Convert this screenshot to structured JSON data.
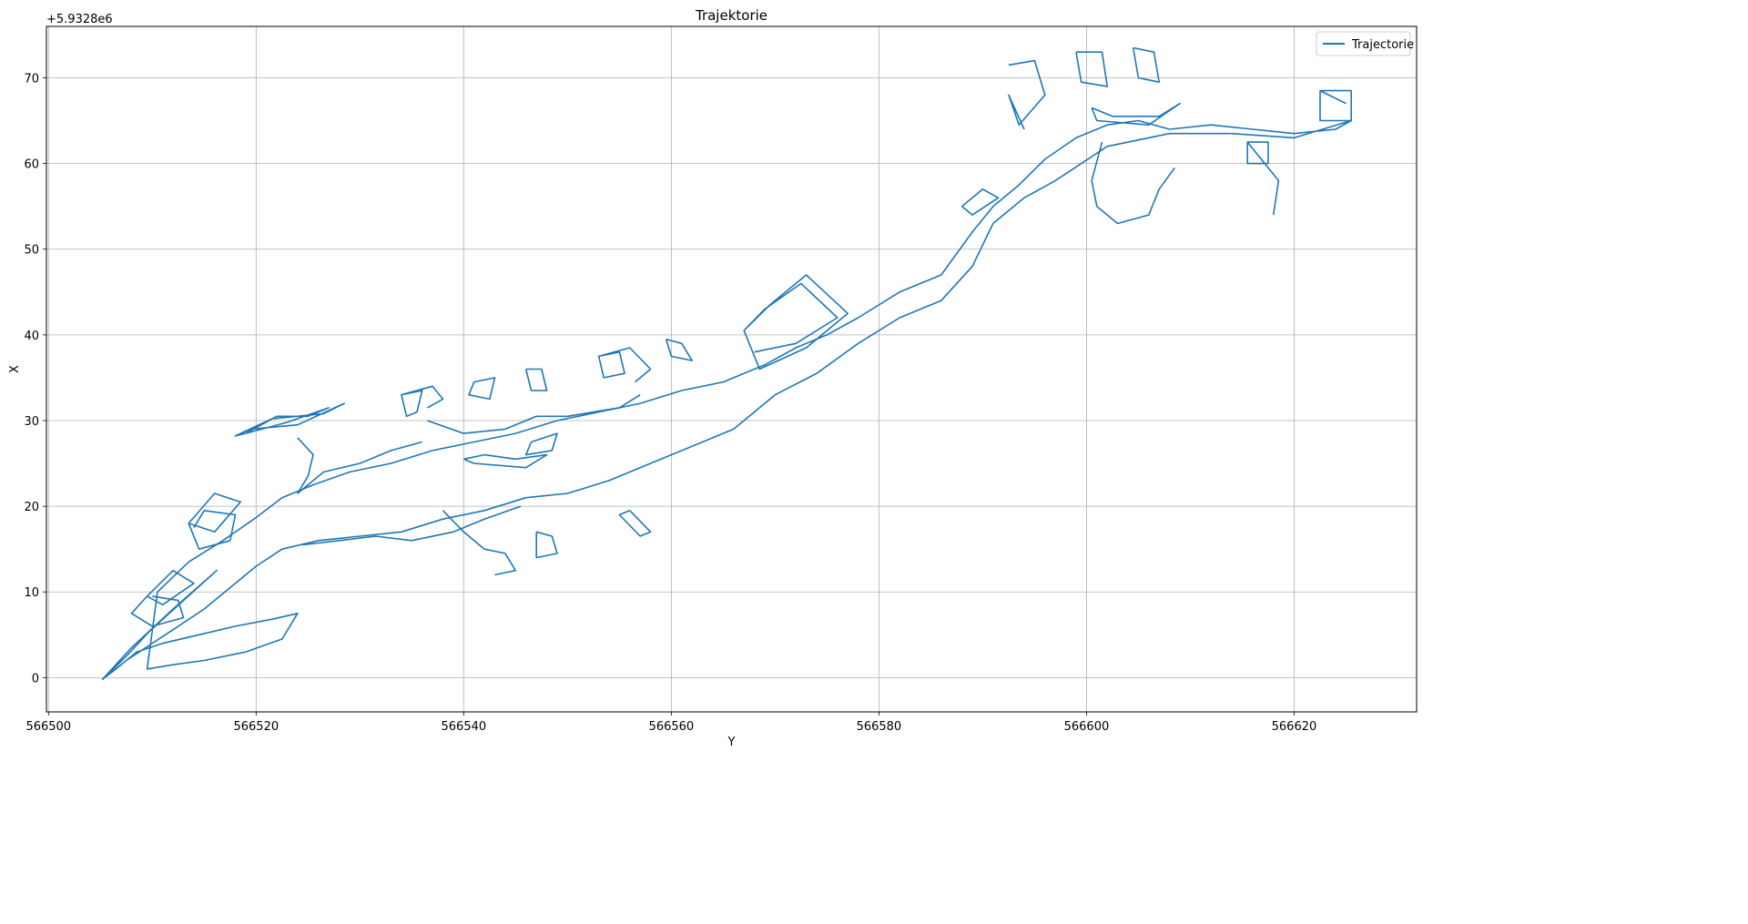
{
  "chart_data": {
    "type": "line",
    "title": "Trajektorie",
    "xlabel": "Y",
    "ylabel": "X",
    "y_offset_label": "+5.9328e6",
    "xlim": [
      566499.8,
      566631.8
    ],
    "ylim": [
      -4,
      76
    ],
    "xticks": [
      566500,
      566520,
      566540,
      566560,
      566580,
      566600,
      566620
    ],
    "yticks": [
      0,
      10,
      20,
      30,
      40,
      50,
      60,
      70
    ],
    "grid": true,
    "legend_position": "top-right",
    "series": [
      {
        "name": "Trajectorie",
        "color": "#1f77b4",
        "x": [
          566505.2,
          566507.5,
          566509.8,
          566513.0,
          566516.2,
          566512.0,
          566508.0,
          566505.2,
          566506.5,
          566508.5,
          566511.0,
          566514.5,
          566518.0,
          566521.5,
          566524.0,
          566522.5,
          566519.0,
          566515.0,
          566512.0,
          566509.5,
          566510.5,
          566513.5,
          566516.8,
          566519.8,
          566522.5,
          566525.5,
          566529.0,
          566533.0,
          566537.0,
          566541.0,
          566545.0,
          566549.0,
          566553.0,
          566557.0,
          566561.0,
          566565.0,
          566569.0,
          566572.0,
          566575.0,
          566578.0,
          566582.0,
          566586.0,
          566589.0,
          566591.0,
          566593.5,
          566596.0,
          566599.0,
          566602.0,
          566605.0,
          566608.0,
          566612.0,
          566616.0,
          566620.0,
          566624.0,
          566625.5,
          566620.0,
          566614.0,
          566608.0,
          566602.0,
          566597.0,
          566594.0,
          566591.0,
          566589.0,
          566586.0,
          566582.0,
          566578.0,
          566574.0,
          566570.0,
          566566.0,
          566562.0,
          566558.0,
          566554.0,
          566550.0,
          566546.0,
          566542.0,
          566538.0,
          566534.0,
          566530.0,
          566526.0,
          566522.5,
          566520.0,
          566517.5,
          566515.0,
          566512.5,
          566510.0,
          566507.5,
          566505.2
        ],
        "y": [
          -0.2,
          2.5,
          5.5,
          9.0,
          12.5,
          8.0,
          3.5,
          -0.2,
          1.0,
          3.0,
          4.0,
          5.0,
          6.0,
          6.8,
          7.5,
          4.5,
          3.0,
          2.0,
          1.5,
          1.0,
          10.0,
          13.5,
          16.0,
          18.5,
          21.0,
          22.5,
          24.0,
          25.0,
          26.5,
          27.5,
          28.5,
          30.0,
          31.0,
          32.0,
          33.5,
          34.5,
          36.5,
          38.5,
          40.0,
          42.0,
          45.0,
          47.0,
          52.0,
          55.0,
          57.5,
          60.5,
          63.0,
          64.5,
          65.0,
          64.0,
          64.5,
          64.0,
          63.5,
          64.0,
          65.0,
          63.0,
          63.5,
          63.5,
          62.0,
          58.0,
          56.0,
          53.0,
          48.0,
          44.0,
          42.0,
          39.0,
          35.5,
          33.0,
          29.0,
          27.0,
          25.0,
          23.0,
          21.5,
          21.0,
          19.5,
          18.5,
          17.0,
          16.5,
          16.0,
          15.0,
          13.0,
          10.5,
          8.0,
          6.0,
          4.0,
          2.0,
          -0.2
        ]
      },
      {
        "name": "",
        "color": "#1f77b4",
        "x": [
          566518.0,
          566521.5,
          566526.5,
          566528.5,
          566524.0,
          566519.5,
          566518.0,
          566519.0,
          566522.0,
          566525.0,
          566527.0,
          566523.0,
          566519.0
        ],
        "y": [
          28.2,
          30.2,
          30.8,
          32.0,
          29.5,
          29.0,
          28.2,
          28.5,
          30.5,
          30.5,
          31.5,
          29.8,
          28.5
        ]
      },
      {
        "name": "",
        "color": "#1f77b4",
        "x": [
          566513.5,
          566516.0,
          566518.5,
          566516.0,
          566513.5,
          566514.5,
          566517.5,
          566518.0,
          566515.0,
          566514.0
        ],
        "y": [
          18.0,
          21.5,
          20.5,
          17.0,
          18.0,
          15.0,
          16.0,
          19.0,
          19.5,
          17.5
        ]
      },
      {
        "name": "",
        "color": "#1f77b4",
        "x": [
          566509.5,
          566512.0,
          566514.0,
          566511.0,
          566509.5,
          566508.0,
          566510.0,
          566513.0,
          566512.5,
          566510.0
        ],
        "y": [
          9.5,
          12.5,
          11.0,
          8.5,
          9.5,
          7.5,
          6.0,
          7.0,
          9.0,
          9.5
        ]
      },
      {
        "name": "",
        "color": "#1f77b4",
        "x": [
          566534.0,
          566536.0,
          566535.5,
          566534.5,
          566534.0,
          566537.0,
          566538.0,
          566536.5
        ],
        "y": [
          33.0,
          33.5,
          31.0,
          30.5,
          33.0,
          34.0,
          32.5,
          31.5
        ]
      },
      {
        "name": "",
        "color": "#1f77b4",
        "x": [
          566541.0,
          566543.0,
          566542.5,
          566540.5,
          566541.0
        ],
        "y": [
          34.5,
          35.0,
          32.5,
          33.0,
          34.5
        ]
      },
      {
        "name": "",
        "color": "#1f77b4",
        "x": [
          566546.0,
          566547.5,
          566548.0,
          566546.5,
          566546.0
        ],
        "y": [
          36.0,
          36.0,
          33.5,
          33.5,
          36.0
        ]
      },
      {
        "name": "",
        "color": "#1f77b4",
        "x": [
          566553.0,
          566555.0,
          566555.5,
          566553.5,
          566553.0,
          566556.0,
          566558.0,
          566556.5
        ],
        "y": [
          37.5,
          38.0,
          35.5,
          35.0,
          37.5,
          38.5,
          36.0,
          34.5
        ]
      },
      {
        "name": "",
        "color": "#1f77b4",
        "x": [
          566559.5,
          566561.0,
          566562.0,
          566560.0,
          566559.5
        ],
        "y": [
          39.5,
          39.0,
          37.0,
          37.5,
          39.5
        ]
      },
      {
        "name": "",
        "color": "#1f77b4",
        "x": [
          566567.0,
          566569.5,
          566573.0,
          566577.0,
          566573.0,
          566568.5,
          566567.0,
          566569.0,
          566572.5,
          566576.0,
          566572.0,
          566568.0
        ],
        "y": [
          40.5,
          43.5,
          47.0,
          42.5,
          38.5,
          36.0,
          40.5,
          43.0,
          46.0,
          42.0,
          39.0,
          38.0
        ]
      },
      {
        "name": "",
        "color": "#1f77b4",
        "x": [
          566546.5,
          566549.0,
          566548.5,
          566546.0,
          566546.5
        ],
        "y": [
          27.5,
          28.5,
          26.5,
          26.0,
          27.5
        ]
      },
      {
        "name": "",
        "color": "#1f77b4",
        "x": [
          566540.0,
          566542.0,
          566545.0,
          566548.0,
          566546.0,
          566541.0,
          566540.0
        ],
        "y": [
          25.5,
          26.0,
          25.5,
          26.0,
          24.5,
          25.0,
          25.5
        ]
      },
      {
        "name": "",
        "color": "#1f77b4",
        "x": [
          566556.0,
          566558.0,
          566557.0,
          566555.0,
          566556.0
        ],
        "y": [
          19.5,
          17.0,
          16.5,
          19.0,
          19.5
        ]
      },
      {
        "name": "",
        "color": "#1f77b4",
        "x": [
          566538.0,
          566540.0,
          566542.0,
          566544.0,
          566545.0,
          566543.0
        ],
        "y": [
          19.5,
          17.0,
          15.0,
          14.5,
          12.5,
          12.0
        ]
      },
      {
        "name": "",
        "color": "#1f77b4",
        "x": [
          566547.0,
          566548.5,
          566549.0,
          566547.0,
          566547.0
        ],
        "y": [
          17.0,
          16.5,
          14.5,
          14.0,
          17.0
        ]
      },
      {
        "name": "",
        "color": "#1f77b4",
        "x": [
          566588.0,
          566590.0,
          566591.5,
          566589.0,
          566588.0
        ],
        "y": [
          55.0,
          57.0,
          56.0,
          54.0,
          55.0
        ]
      },
      {
        "name": "",
        "color": "#1f77b4",
        "x": [
          566592.5,
          566595.0,
          566596.0,
          566593.5,
          566592.5,
          566594.0
        ],
        "y": [
          71.5,
          72.0,
          68.0,
          64.5,
          68.0,
          64.0
        ]
      },
      {
        "name": "",
        "color": "#1f77b4",
        "x": [
          566599.0,
          566601.5,
          566602.0,
          566599.5,
          566599.0
        ],
        "y": [
          73.0,
          73.0,
          69.0,
          69.5,
          73.0
        ]
      },
      {
        "name": "",
        "color": "#1f77b4",
        "x": [
          566604.5,
          566606.5,
          566607.0,
          566605.0,
          566604.5
        ],
        "y": [
          73.5,
          73.0,
          69.5,
          70.0,
          73.5
        ]
      },
      {
        "name": "",
        "color": "#1f77b4",
        "x": [
          566600.5,
          566602.5,
          566607.0,
          566609.0,
          566606.0,
          566601.0,
          566600.5
        ],
        "y": [
          66.5,
          65.5,
          65.5,
          67.0,
          64.5,
          65.0,
          66.5
        ]
      },
      {
        "name": "",
        "color": "#1f77b4",
        "x": [
          566601.5,
          566600.5,
          566601.0,
          566603.0,
          566606.0,
          566607.0,
          566608.5
        ],
        "y": [
          62.5,
          58.0,
          55.0,
          53.0,
          54.0,
          57.0,
          59.5
        ]
      },
      {
        "name": "",
        "color": "#1f77b4",
        "x": [
          566615.5,
          566617.5,
          566617.5,
          566615.5,
          566615.5,
          566616.5,
          566618.5,
          566618.0
        ],
        "y": [
          62.5,
          62.5,
          60.0,
          60.0,
          62.5,
          61.0,
          58.0,
          54.0
        ]
      },
      {
        "name": "",
        "color": "#1f77b4",
        "x": [
          566622.5,
          566625.5,
          566625.5,
          566622.5,
          566622.5,
          566625.0
        ],
        "y": [
          68.5,
          68.5,
          65.0,
          65.0,
          68.5,
          67.0
        ]
      },
      {
        "name": "",
        "color": "#1f77b4",
        "x": [
          566536.5,
          566540.0,
          566544.0,
          566547.0,
          566550.0,
          566552.5,
          566555.0,
          566557.0
        ],
        "y": [
          30.0,
          28.5,
          29.0,
          30.5,
          30.5,
          31.0,
          31.5,
          33.0
        ]
      },
      {
        "name": "",
        "color": "#1f77b4",
        "x": [
          566524.5,
          566528.0,
          566531.5,
          566535.0,
          566539.0,
          566542.0,
          566545.5
        ],
        "y": [
          15.5,
          16.0,
          16.5,
          16.0,
          17.0,
          18.5,
          20.0
        ]
      },
      {
        "name": "",
        "color": "#1f77b4",
        "x": [
          566524.0,
          566525.5,
          566525.0,
          566524.0,
          566526.5,
          566530.0,
          566533.0,
          566536.0
        ],
        "y": [
          28.0,
          26.0,
          23.5,
          21.5,
          24.0,
          25.0,
          26.5,
          27.5
        ]
      }
    ]
  }
}
